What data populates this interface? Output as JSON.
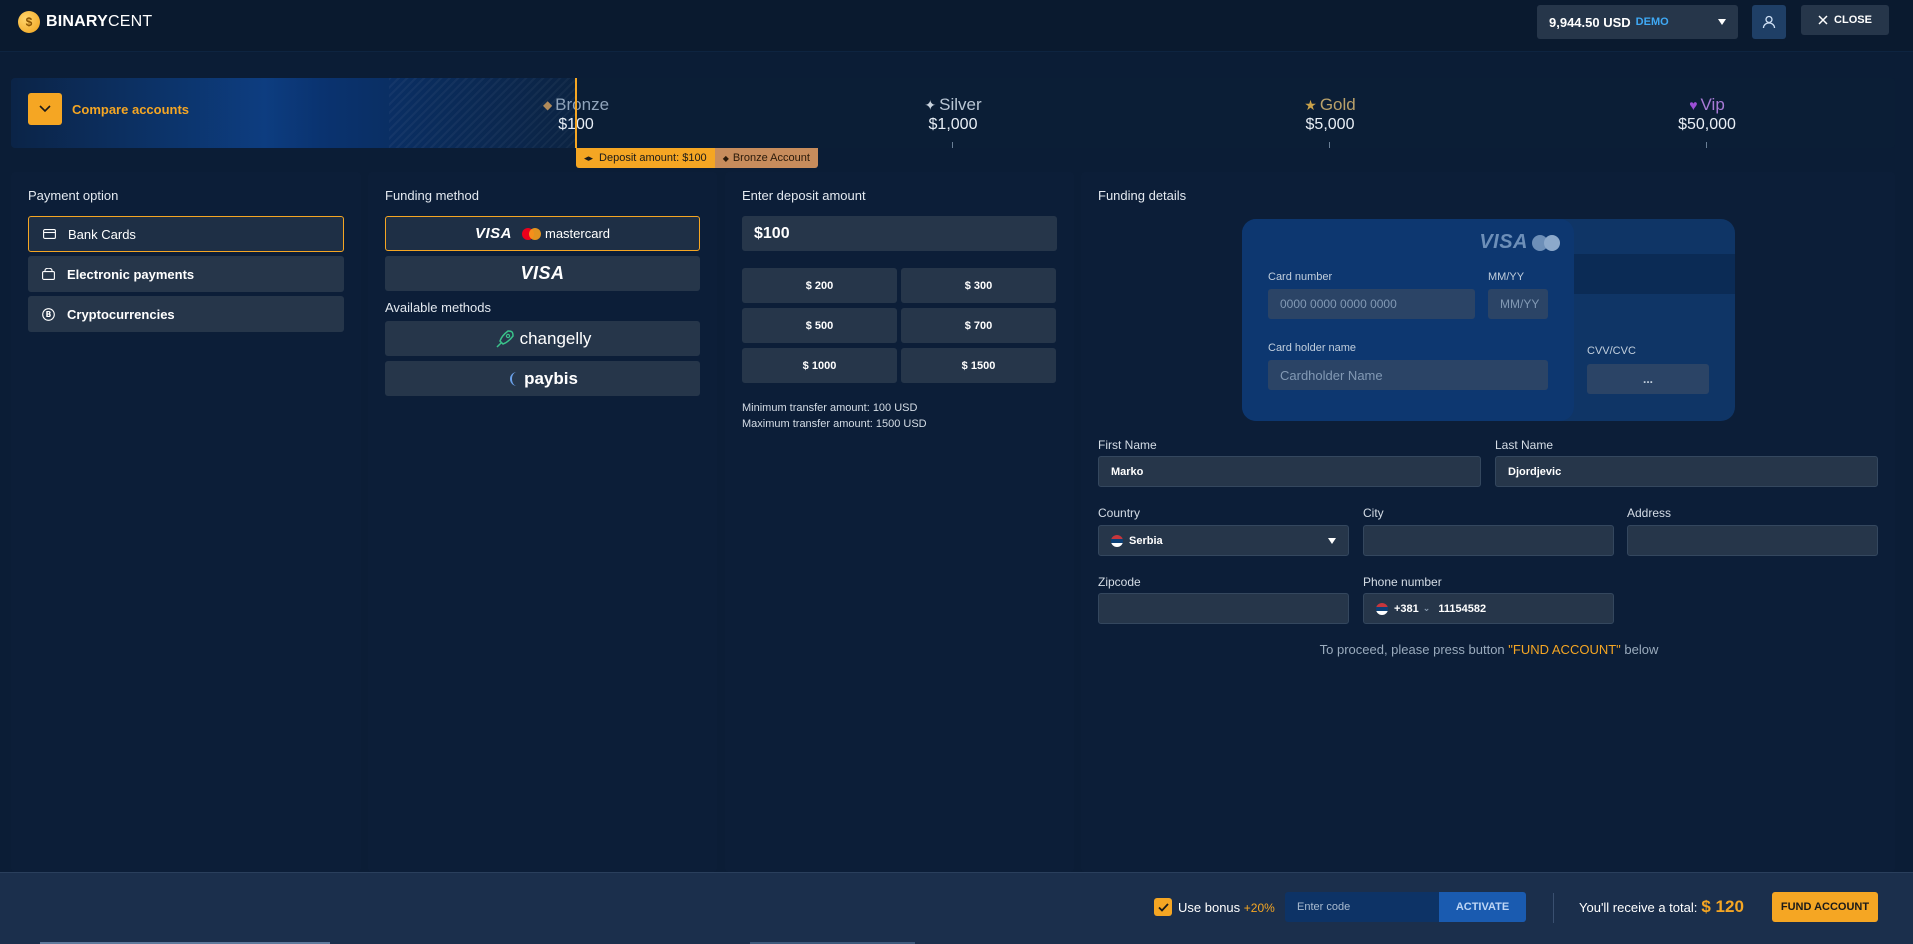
{
  "header": {
    "logo_bold": "BINARY",
    "logo_thin": "CENT",
    "balance": "9,944.50 USD",
    "account_mode": "DEMO",
    "close_label": "CLOSE"
  },
  "tiers": {
    "compare_label": "Compare accounts",
    "items": [
      {
        "name": "Bronze",
        "value": "$100",
        "icon": "diamond-icon",
        "color": "#b08a5a"
      },
      {
        "name": "Silver",
        "value": "$1,000",
        "icon": "sparkle-icon",
        "color": "#c9d3de"
      },
      {
        "name": "Gold",
        "value": "$5,000",
        "icon": "star-icon",
        "color": "#c9a24a"
      },
      {
        "name": "Vip",
        "value": "$50,000",
        "icon": "heart-icon",
        "color": "#9b4fd6"
      }
    ],
    "deposit_tag": "Deposit amount: $100",
    "account_tag": "Bronze Account"
  },
  "payment_option": {
    "title": "Payment option",
    "items": [
      {
        "label": "Bank Cards",
        "icon": "credit-card-icon",
        "active": true
      },
      {
        "label": "Electronic payments",
        "icon": "wallet-icon",
        "active": false
      },
      {
        "label": "Cryptocurrencies",
        "icon": "bitcoin-icon",
        "active": false
      }
    ]
  },
  "funding_method": {
    "title": "Funding method",
    "visa_label": "VISA",
    "mastercard_label": "mastercard",
    "available_title": "Available methods",
    "changelly_label": "changelly",
    "paybis_label": "paybis"
  },
  "deposit": {
    "title": "Enter deposit amount",
    "amount": "$100",
    "presets": [
      "$ 200",
      "$ 300",
      "$ 500",
      "$ 700",
      "$ 1000",
      "$ 1500"
    ],
    "min_text": "Minimum transfer amount: 100 USD",
    "max_text": "Maximum transfer amount: 1500 USD"
  },
  "funding_details": {
    "title": "Funding details",
    "card": {
      "brand": "VISA",
      "number_label": "Card number",
      "number_placeholder": "0000 0000 0000 0000",
      "expiry_label": "MM/YY",
      "expiry_placeholder": "MM/YY",
      "holder_label": "Card holder name",
      "holder_placeholder": "Cardholder Name",
      "cvv_label": "CVV/CVC",
      "cvv_placeholder": "..."
    },
    "first_name_label": "First Name",
    "first_name": "Marko",
    "last_name_label": "Last Name",
    "last_name": "Djordjevic",
    "country_label": "Country",
    "country": "Serbia",
    "city_label": "City",
    "city": "",
    "address_label": "Address",
    "address": "",
    "zipcode_label": "Zipcode",
    "zipcode": "",
    "phone_label": "Phone number",
    "phone_code": "+381",
    "phone": "11154582",
    "proceed_pre": "To proceed, please press button ",
    "proceed_hl": "\"FUND ACCOUNT\"",
    "proceed_post": " below"
  },
  "footer": {
    "bonus_label": "Use bonus",
    "bonus_pct": "+20%",
    "code_placeholder": "Enter code",
    "activate_label": "ACTIVATE",
    "total_label": "You'll receive a total:",
    "total_amount": "$ 120",
    "fund_label": "FUND ACCOUNT"
  },
  "colors": {
    "accent": "#f5a623",
    "background": "#0b1d36",
    "panel": "#0c1e38",
    "control": "#26364a"
  }
}
